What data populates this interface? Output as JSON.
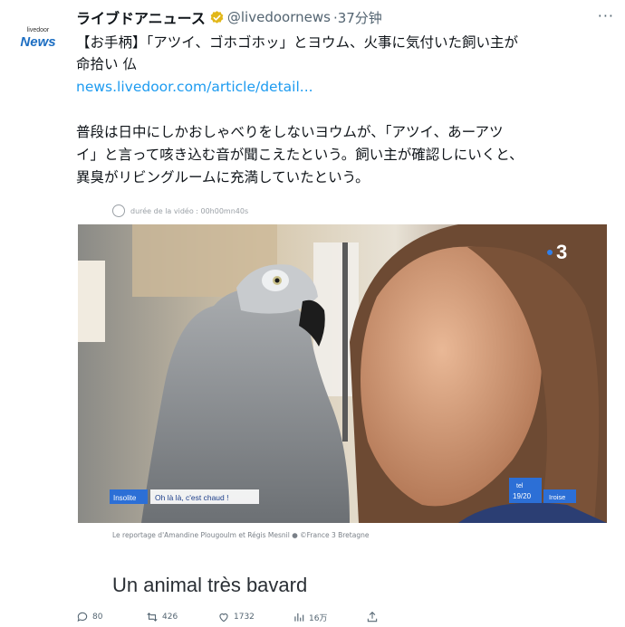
{
  "avatar": {
    "small": "livedoor",
    "big": "News"
  },
  "tweet": {
    "author": "ライブドアニュース",
    "handle": "@livedoornews",
    "time": "·37分钟",
    "lines": [
      "【お手柄】「アツイ、ゴホゴホッ」とヨウム、火事に気付いた飼い主が",
      "命拾い 仏",
      "",
      "普段は日中にしかおしゃべりをしないヨウムが、「アツイ、あーアツ",
      "イ」と言って咳き込む音が聞こえたという。飼い主が確認しにいくと、",
      "異臭がリビングルームに充満していたという。"
    ],
    "link": "news.livedoor.com/article/detail..."
  },
  "media": {
    "duration": "durée de la vidéo : 00h00mn40s",
    "channel": "3",
    "tag_label": "Insolite",
    "tag_quote": "Oh là là, c'est chaud !",
    "brand_top": "tel",
    "brand_time": "19/20",
    "brand_region": "Iroise",
    "caption": "Le reportage d'Amandine Plougoulm et Régis Mesnil ● ©France 3 Bretagne",
    "heading": "Un animal très bavard"
  },
  "actions": {
    "reply": "80",
    "retweet": "426",
    "like": "1732",
    "views": "16万"
  },
  "colors": {
    "link": "#1d9bf0",
    "verified": "#e2b719",
    "text": "#0f1419",
    "muted": "#536471"
  }
}
